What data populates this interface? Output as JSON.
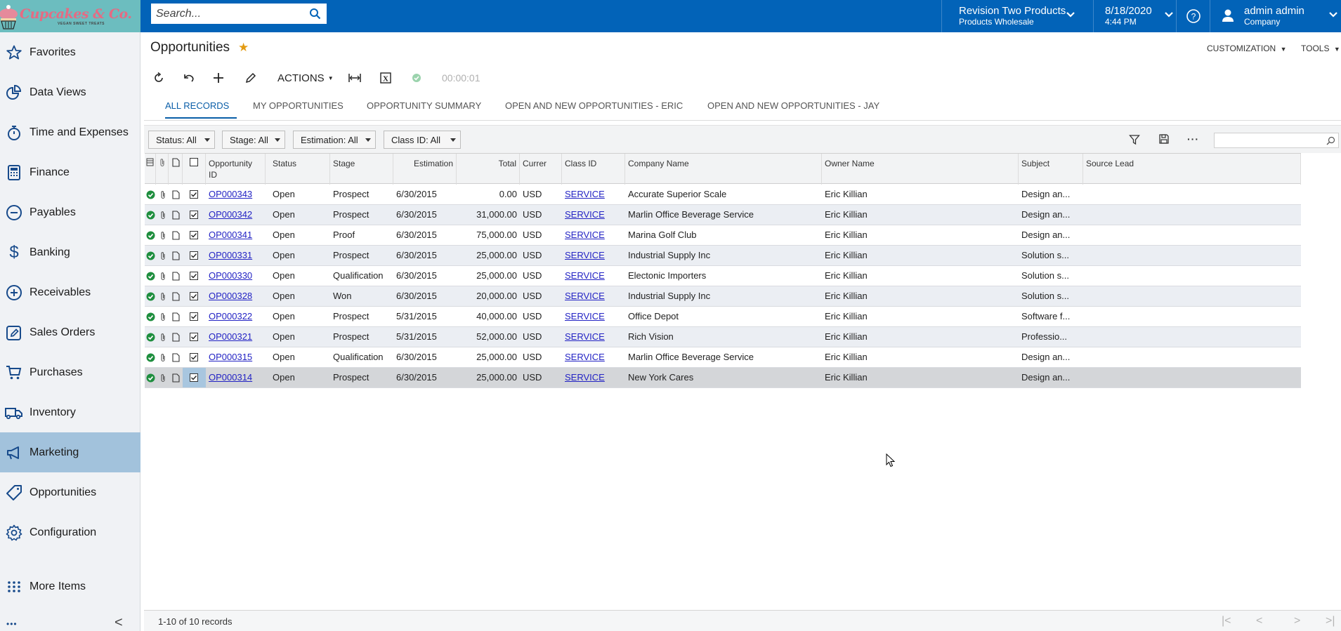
{
  "brand": {
    "name": "Cupcakes & Co.",
    "tagline": "VEGAN SWEET TREATS"
  },
  "search": {
    "placeholder": "Search..."
  },
  "topbar": {
    "company_line1": "Revision Two Products",
    "company_line2": "Products Wholesale",
    "date": "8/18/2020",
    "time": "4:44 PM",
    "user_name": "admin admin",
    "user_company": "Company"
  },
  "sidebar": {
    "items": [
      {
        "label": "Favorites",
        "icon": "star-icon"
      },
      {
        "label": "Data Views",
        "icon": "pie-chart-icon"
      },
      {
        "label": "Time and Expenses",
        "icon": "stopwatch-icon"
      },
      {
        "label": "Finance",
        "icon": "calculator-icon"
      },
      {
        "label": "Payables",
        "icon": "minus-circle-icon"
      },
      {
        "label": "Banking",
        "icon": "dollar-icon"
      },
      {
        "label": "Receivables",
        "icon": "plus-circle-icon"
      },
      {
        "label": "Sales Orders",
        "icon": "edit-square-icon"
      },
      {
        "label": "Purchases",
        "icon": "cart-icon"
      },
      {
        "label": "Inventory",
        "icon": "truck-icon"
      },
      {
        "label": "Marketing",
        "icon": "megaphone-icon",
        "active": true
      },
      {
        "label": "Opportunities",
        "icon": "tag-icon"
      },
      {
        "label": "Configuration",
        "icon": "gear-icon"
      }
    ],
    "more_items": "More Items",
    "collapse_glyph": "<",
    "ellipsis": "•••"
  },
  "page": {
    "title": "Opportunities",
    "customization": "CUSTOMIZATION",
    "tools": "TOOLS",
    "actions_label": "ACTIONS",
    "timer": "00:00:01"
  },
  "tabs": [
    {
      "label": "ALL RECORDS",
      "active": true
    },
    {
      "label": "MY OPPORTUNITIES"
    },
    {
      "label": "OPPORTUNITY SUMMARY"
    },
    {
      "label": "OPEN AND NEW OPPORTUNITIES - ERIC"
    },
    {
      "label": "OPEN AND NEW OPPORTUNITIES - JAY"
    }
  ],
  "filters": [
    {
      "label": "Status: All"
    },
    {
      "label": "Stage: All"
    },
    {
      "label": "Estimation: All"
    },
    {
      "label": "Class ID: All"
    }
  ],
  "grid": {
    "columns": [
      {
        "key": "opportunity_id",
        "label": "Opportunity ID"
      },
      {
        "key": "status",
        "label": "Status"
      },
      {
        "key": "stage",
        "label": "Stage"
      },
      {
        "key": "estimation",
        "label": "Estimation"
      },
      {
        "key": "total",
        "label": "Total"
      },
      {
        "key": "currency",
        "label": "Currer"
      },
      {
        "key": "class_id",
        "label": "Class ID"
      },
      {
        "key": "company_name",
        "label": "Company Name"
      },
      {
        "key": "owner_name",
        "label": "Owner Name"
      },
      {
        "key": "subject",
        "label": "Subject"
      },
      {
        "key": "source_lead",
        "label": "Source Lead"
      }
    ],
    "rows": [
      {
        "opportunity_id": "OP000343",
        "status": "Open",
        "stage": "Prospect",
        "estimation": "6/30/2015",
        "total": "0.00",
        "currency": "USD",
        "class_id": "SERVICE",
        "company_name": "Accurate Superior Scale",
        "owner_name": "Eric Killian",
        "subject": "Design an...",
        "source_lead": ""
      },
      {
        "opportunity_id": "OP000342",
        "status": "Open",
        "stage": "Prospect",
        "estimation": "6/30/2015",
        "total": "31,000.00",
        "currency": "USD",
        "class_id": "SERVICE",
        "company_name": "Marlin Office Beverage Service",
        "owner_name": "Eric Killian",
        "subject": "Design an...",
        "source_lead": ""
      },
      {
        "opportunity_id": "OP000341",
        "status": "Open",
        "stage": "Proof",
        "estimation": "6/30/2015",
        "total": "75,000.00",
        "currency": "USD",
        "class_id": "SERVICE",
        "company_name": "Marina Golf Club",
        "owner_name": "Eric Killian",
        "subject": "Design an...",
        "source_lead": ""
      },
      {
        "opportunity_id": "OP000331",
        "status": "Open",
        "stage": "Prospect",
        "estimation": "6/30/2015",
        "total": "25,000.00",
        "currency": "USD",
        "class_id": "SERVICE",
        "company_name": "Industrial Supply Inc",
        "owner_name": "Eric Killian",
        "subject": "Solution s...",
        "source_lead": ""
      },
      {
        "opportunity_id": "OP000330",
        "status": "Open",
        "stage": "Qualification",
        "estimation": "6/30/2015",
        "total": "25,000.00",
        "currency": "USD",
        "class_id": "SERVICE",
        "company_name": "Electonic Importers",
        "owner_name": "Eric Killian",
        "subject": "Solution s...",
        "source_lead": ""
      },
      {
        "opportunity_id": "OP000328",
        "status": "Open",
        "stage": "Won",
        "estimation": "6/30/2015",
        "total": "20,000.00",
        "currency": "USD",
        "class_id": "SERVICE",
        "company_name": "Industrial Supply Inc",
        "owner_name": "Eric Killian",
        "subject": "Solution s...",
        "source_lead": ""
      },
      {
        "opportunity_id": "OP000322",
        "status": "Open",
        "stage": "Prospect",
        "estimation": "5/31/2015",
        "total": "40,000.00",
        "currency": "USD",
        "class_id": "SERVICE",
        "company_name": "Office Depot",
        "owner_name": "Eric Killian",
        "subject": "Software f...",
        "source_lead": ""
      },
      {
        "opportunity_id": "OP000321",
        "status": "Open",
        "stage": "Prospect",
        "estimation": "5/31/2015",
        "total": "52,000.00",
        "currency": "USD",
        "class_id": "SERVICE",
        "company_name": "Rich Vision",
        "owner_name": "Eric Killian",
        "subject": "Professio...",
        "source_lead": ""
      },
      {
        "opportunity_id": "OP000315",
        "status": "Open",
        "stage": "Qualification",
        "estimation": "6/30/2015",
        "total": "25,000.00",
        "currency": "USD",
        "class_id": "SERVICE",
        "company_name": "Marlin Office Beverage Service",
        "owner_name": "Eric Killian",
        "subject": "Design an...",
        "source_lead": ""
      },
      {
        "opportunity_id": "OP000314",
        "status": "Open",
        "stage": "Prospect",
        "estimation": "6/30/2015",
        "total": "25,000.00",
        "currency": "USD",
        "class_id": "SERVICE",
        "company_name": "New York Cares",
        "owner_name": "Eric Killian",
        "subject": "Design an...",
        "source_lead": "",
        "selected": true
      }
    ]
  },
  "footer": {
    "record_count": "1-10 of 10 records"
  },
  "colors": {
    "topbar": "#0263b8",
    "brand_bg": "#6cbdbf",
    "brand_text": "#e56b83",
    "accent": "#0a5ea8",
    "active_nav": "#a2c2dc",
    "star": "#e39b12",
    "status_ok": "#1e8e3e",
    "link": "#2323c4"
  }
}
